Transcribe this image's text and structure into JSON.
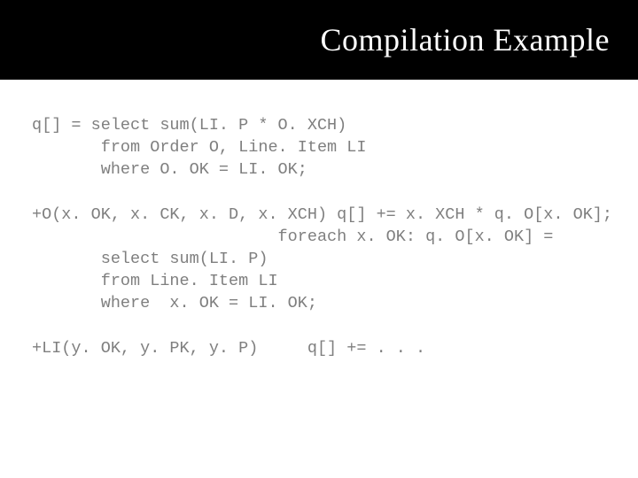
{
  "title": "Compilation Example",
  "code": {
    "line1": "q[] = select sum(LI. P * O. XCH)",
    "line2": "       from Order O, Line. Item LI",
    "line3": "       where O. OK = LI. OK;",
    "line4": "+O(x. OK, x. CK, x. D, x. XCH) q[] += x. XCH * q. O[x. OK];",
    "line5": "                         foreach x. OK: q. O[x. OK] =",
    "line6": "       select sum(LI. P)",
    "line7": "       from Line. Item LI",
    "line8": "       where  x. OK = LI. OK;",
    "line9": "+LI(y. OK, y. PK, y. P)     q[] += . . ."
  }
}
